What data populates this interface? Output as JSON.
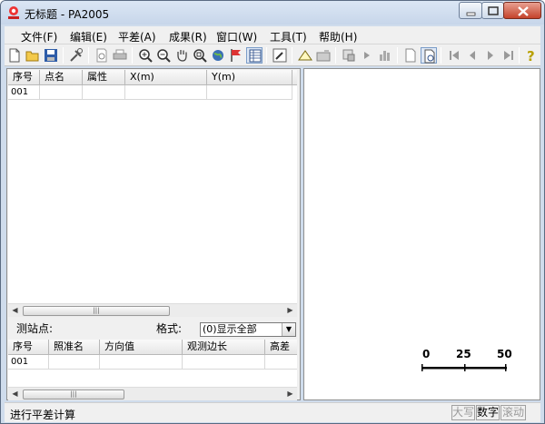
{
  "window": {
    "title": "无标题 - PA2005"
  },
  "menu": [
    {
      "label": "文件(F)"
    },
    {
      "label": "编辑(E)"
    },
    {
      "label": "平差(A)"
    },
    {
      "label": "成果(R)"
    },
    {
      "label": "窗口(W)"
    },
    {
      "label": "工具(T)"
    },
    {
      "label": "帮助(H)"
    }
  ],
  "toolbar": {
    "icons": [
      "new-file-icon",
      "open-folder-icon",
      "save-disk-icon",
      "tools-icon",
      "print-preview-icon",
      "print-icon",
      "zoom-in-icon",
      "zoom-out-icon",
      "pan-hand-icon",
      "zoom-window-icon",
      "globe-icon",
      "flag-icon",
      "table-view-icon",
      "edit-icon",
      "triangle-icon",
      "camera-icon",
      "scan-icon",
      "play-icon",
      "chart-bars-icon",
      "blank-page-icon",
      "page-select-icon",
      "first-icon",
      "prev-icon",
      "next-icon",
      "last-icon",
      "help-icon"
    ]
  },
  "point_table": {
    "columns": [
      "序号",
      "点名",
      "属性",
      "X(m)",
      "Y(m)"
    ],
    "rows": [
      {
        "id": "001",
        "name": "",
        "attr": "",
        "x": "",
        "y": ""
      }
    ]
  },
  "station": {
    "label": "测站点:",
    "format_label": "格式:",
    "format_value": "(0)显示全部"
  },
  "obs_table": {
    "columns": [
      "序号",
      "照准名",
      "方向值",
      "观测边长",
      "高差"
    ],
    "rows": [
      {
        "id": "001",
        "target": "",
        "dir": "",
        "dist": "",
        "dh": ""
      }
    ]
  },
  "scale_bar": {
    "ticks": [
      "0",
      "25",
      "50"
    ]
  },
  "status": {
    "text": "进行平差计算",
    "caps": "大写",
    "num": "数字",
    "scroll": "滚动"
  }
}
